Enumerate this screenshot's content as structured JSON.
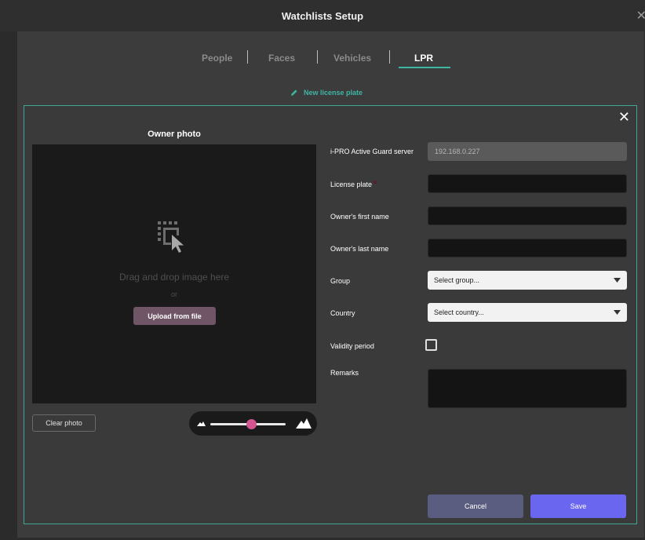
{
  "window": {
    "title": "Watchlists Setup",
    "close_glyph": "✕"
  },
  "tabs": [
    {
      "label": "People",
      "active": false
    },
    {
      "label": "Faces",
      "active": false
    },
    {
      "label": "Vehicles",
      "active": false
    },
    {
      "label": "LPR",
      "active": true
    }
  ],
  "new_plate": {
    "label": "New license plate",
    "icon": "pencil-icon"
  },
  "panel": {
    "close_glyph": "✕"
  },
  "photo": {
    "title": "Owner photo",
    "drop_text": "Drag and drop image here",
    "or_text": "or",
    "upload_label": "Upload from file",
    "clear_label": "Clear photo",
    "zoom_level": 0.55
  },
  "form": {
    "server": {
      "label": "i-PRO Active Guard server",
      "value": "192.168.0.227"
    },
    "license_plate": {
      "label": "License plate",
      "value": ""
    },
    "first_name": {
      "label": "Owner's first name",
      "value": ""
    },
    "last_name": {
      "label": "Owner's last name",
      "value": ""
    },
    "group": {
      "label": "Group",
      "placeholder": "Select group..."
    },
    "country": {
      "label": "Country",
      "placeholder": "Select country..."
    },
    "validity": {
      "label": "Validity period",
      "checked": false
    },
    "remarks": {
      "label": "Remarks",
      "value": ""
    }
  },
  "actions": {
    "cancel_label": "Cancel",
    "save_label": "Save"
  },
  "colors": {
    "accent": "#3fb5a3",
    "save": "#6a66f0",
    "cancel": "#5a5d80",
    "upload": "#6f5565",
    "slider_thumb": "#d45690"
  }
}
